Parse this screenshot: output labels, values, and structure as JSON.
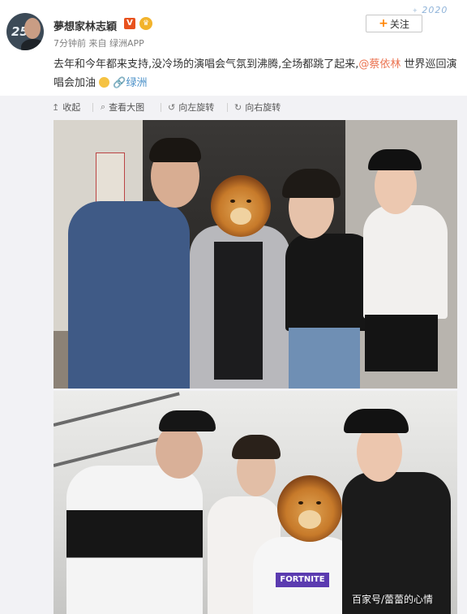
{
  "post": {
    "author": "夢想家林志穎",
    "meta": "7分钟前 来自 绿洲APP",
    "text_before": "去年和今年都来支持,没冷场的演唱会气氛到沸腾,全场都跳了起来,",
    "mention": "@蔡依林",
    "text_after": " 世界巡回演唱会加油",
    "location": "绿洲",
    "follow_label": "关注",
    "deco_text": "2020"
  },
  "toolbar": {
    "collapse": "收起",
    "view_large": "查看大图",
    "rotate_left": "向左旋转",
    "rotate_right": "向右旋转"
  },
  "watermark": "百家号/蕾蕾的心情",
  "icons": {
    "collapse": "collapse-icon",
    "search": "search-icon",
    "rotate_left": "rotate-left-icon",
    "rotate_right": "rotate-right-icon",
    "location": "link-icon",
    "emoji": "flex-arm-emoji-icon"
  },
  "colors": {
    "mention": "#eb7350",
    "link": "#4a90c8",
    "follow_plus": "#ff8200",
    "toolbar_bg": "#f2f2f5"
  }
}
